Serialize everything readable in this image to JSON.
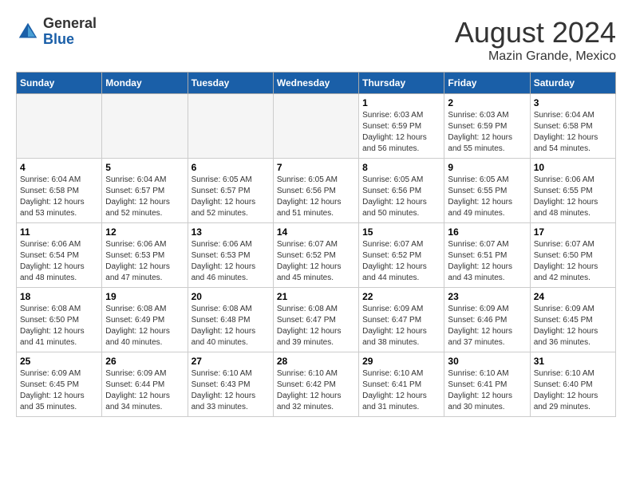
{
  "header": {
    "logo_general": "General",
    "logo_blue": "Blue",
    "month_title": "August 2024",
    "location": "Mazin Grande, Mexico"
  },
  "weekdays": [
    "Sunday",
    "Monday",
    "Tuesday",
    "Wednesday",
    "Thursday",
    "Friday",
    "Saturday"
  ],
  "weeks": [
    [
      {
        "day": "",
        "empty": true
      },
      {
        "day": "",
        "empty": true
      },
      {
        "day": "",
        "empty": true
      },
      {
        "day": "",
        "empty": true
      },
      {
        "day": "1",
        "sunrise": "6:03 AM",
        "sunset": "6:59 PM",
        "daylight": "12 hours and 56 minutes."
      },
      {
        "day": "2",
        "sunrise": "6:03 AM",
        "sunset": "6:59 PM",
        "daylight": "12 hours and 55 minutes."
      },
      {
        "day": "3",
        "sunrise": "6:04 AM",
        "sunset": "6:58 PM",
        "daylight": "12 hours and 54 minutes."
      }
    ],
    [
      {
        "day": "4",
        "sunrise": "6:04 AM",
        "sunset": "6:58 PM",
        "daylight": "12 hours and 53 minutes."
      },
      {
        "day": "5",
        "sunrise": "6:04 AM",
        "sunset": "6:57 PM",
        "daylight": "12 hours and 52 minutes."
      },
      {
        "day": "6",
        "sunrise": "6:05 AM",
        "sunset": "6:57 PM",
        "daylight": "12 hours and 52 minutes."
      },
      {
        "day": "7",
        "sunrise": "6:05 AM",
        "sunset": "6:56 PM",
        "daylight": "12 hours and 51 minutes."
      },
      {
        "day": "8",
        "sunrise": "6:05 AM",
        "sunset": "6:56 PM",
        "daylight": "12 hours and 50 minutes."
      },
      {
        "day": "9",
        "sunrise": "6:05 AM",
        "sunset": "6:55 PM",
        "daylight": "12 hours and 49 minutes."
      },
      {
        "day": "10",
        "sunrise": "6:06 AM",
        "sunset": "6:55 PM",
        "daylight": "12 hours and 48 minutes."
      }
    ],
    [
      {
        "day": "11",
        "sunrise": "6:06 AM",
        "sunset": "6:54 PM",
        "daylight": "12 hours and 48 minutes."
      },
      {
        "day": "12",
        "sunrise": "6:06 AM",
        "sunset": "6:53 PM",
        "daylight": "12 hours and 47 minutes."
      },
      {
        "day": "13",
        "sunrise": "6:06 AM",
        "sunset": "6:53 PM",
        "daylight": "12 hours and 46 minutes."
      },
      {
        "day": "14",
        "sunrise": "6:07 AM",
        "sunset": "6:52 PM",
        "daylight": "12 hours and 45 minutes."
      },
      {
        "day": "15",
        "sunrise": "6:07 AM",
        "sunset": "6:52 PM",
        "daylight": "12 hours and 44 minutes."
      },
      {
        "day": "16",
        "sunrise": "6:07 AM",
        "sunset": "6:51 PM",
        "daylight": "12 hours and 43 minutes."
      },
      {
        "day": "17",
        "sunrise": "6:07 AM",
        "sunset": "6:50 PM",
        "daylight": "12 hours and 42 minutes."
      }
    ],
    [
      {
        "day": "18",
        "sunrise": "6:08 AM",
        "sunset": "6:50 PM",
        "daylight": "12 hours and 41 minutes."
      },
      {
        "day": "19",
        "sunrise": "6:08 AM",
        "sunset": "6:49 PM",
        "daylight": "12 hours and 40 minutes."
      },
      {
        "day": "20",
        "sunrise": "6:08 AM",
        "sunset": "6:48 PM",
        "daylight": "12 hours and 40 minutes."
      },
      {
        "day": "21",
        "sunrise": "6:08 AM",
        "sunset": "6:47 PM",
        "daylight": "12 hours and 39 minutes."
      },
      {
        "day": "22",
        "sunrise": "6:09 AM",
        "sunset": "6:47 PM",
        "daylight": "12 hours and 38 minutes."
      },
      {
        "day": "23",
        "sunrise": "6:09 AM",
        "sunset": "6:46 PM",
        "daylight": "12 hours and 37 minutes."
      },
      {
        "day": "24",
        "sunrise": "6:09 AM",
        "sunset": "6:45 PM",
        "daylight": "12 hours and 36 minutes."
      }
    ],
    [
      {
        "day": "25",
        "sunrise": "6:09 AM",
        "sunset": "6:45 PM",
        "daylight": "12 hours and 35 minutes."
      },
      {
        "day": "26",
        "sunrise": "6:09 AM",
        "sunset": "6:44 PM",
        "daylight": "12 hours and 34 minutes."
      },
      {
        "day": "27",
        "sunrise": "6:10 AM",
        "sunset": "6:43 PM",
        "daylight": "12 hours and 33 minutes."
      },
      {
        "day": "28",
        "sunrise": "6:10 AM",
        "sunset": "6:42 PM",
        "daylight": "12 hours and 32 minutes."
      },
      {
        "day": "29",
        "sunrise": "6:10 AM",
        "sunset": "6:41 PM",
        "daylight": "12 hours and 31 minutes."
      },
      {
        "day": "30",
        "sunrise": "6:10 AM",
        "sunset": "6:41 PM",
        "daylight": "12 hours and 30 minutes."
      },
      {
        "day": "31",
        "sunrise": "6:10 AM",
        "sunset": "6:40 PM",
        "daylight": "12 hours and 29 minutes."
      }
    ]
  ]
}
